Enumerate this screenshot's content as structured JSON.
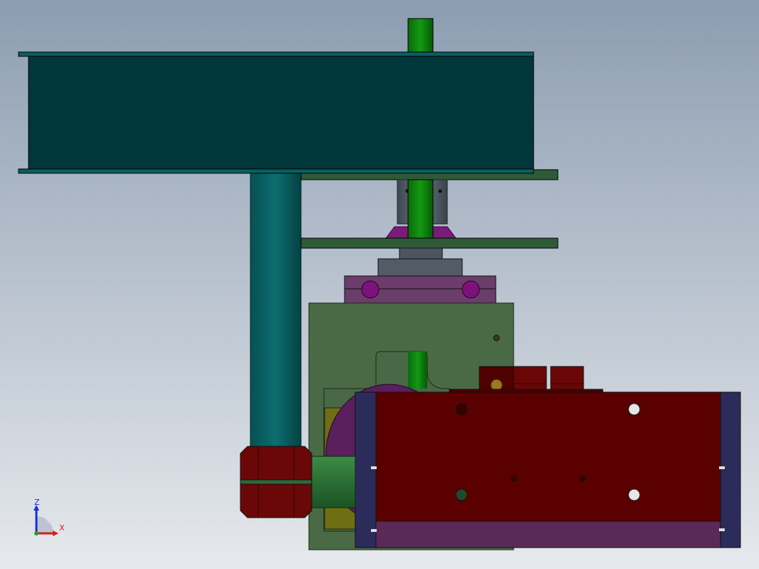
{
  "viewport": {
    "background_top": "#8c9db1",
    "background_bottom": "#e6e9ed",
    "colors": {
      "beam_face": "#01363a",
      "beam_edge": "#0b5e63",
      "column": "#0a5b5e",
      "shaft": "#0a7a0a",
      "plate": "#2f5a37",
      "bracket_purple": "#6a3d6a",
      "body_gray": "#505a64",
      "housing_green": "#4a6a46",
      "motor_red": "#5a0000",
      "end_cap_navy": "#2c2c5a",
      "lower_strip": "#5a2a57",
      "coupling_green": "#2e7a3a",
      "knob_red": "#6a0808",
      "rotor_purple": "#5a1f5c",
      "inner_yellow": "#6e6e12"
    }
  },
  "triad": {
    "z_label": "Z",
    "x_label": "X",
    "z_color": "#1a2adf",
    "x_color": "#e01818"
  }
}
